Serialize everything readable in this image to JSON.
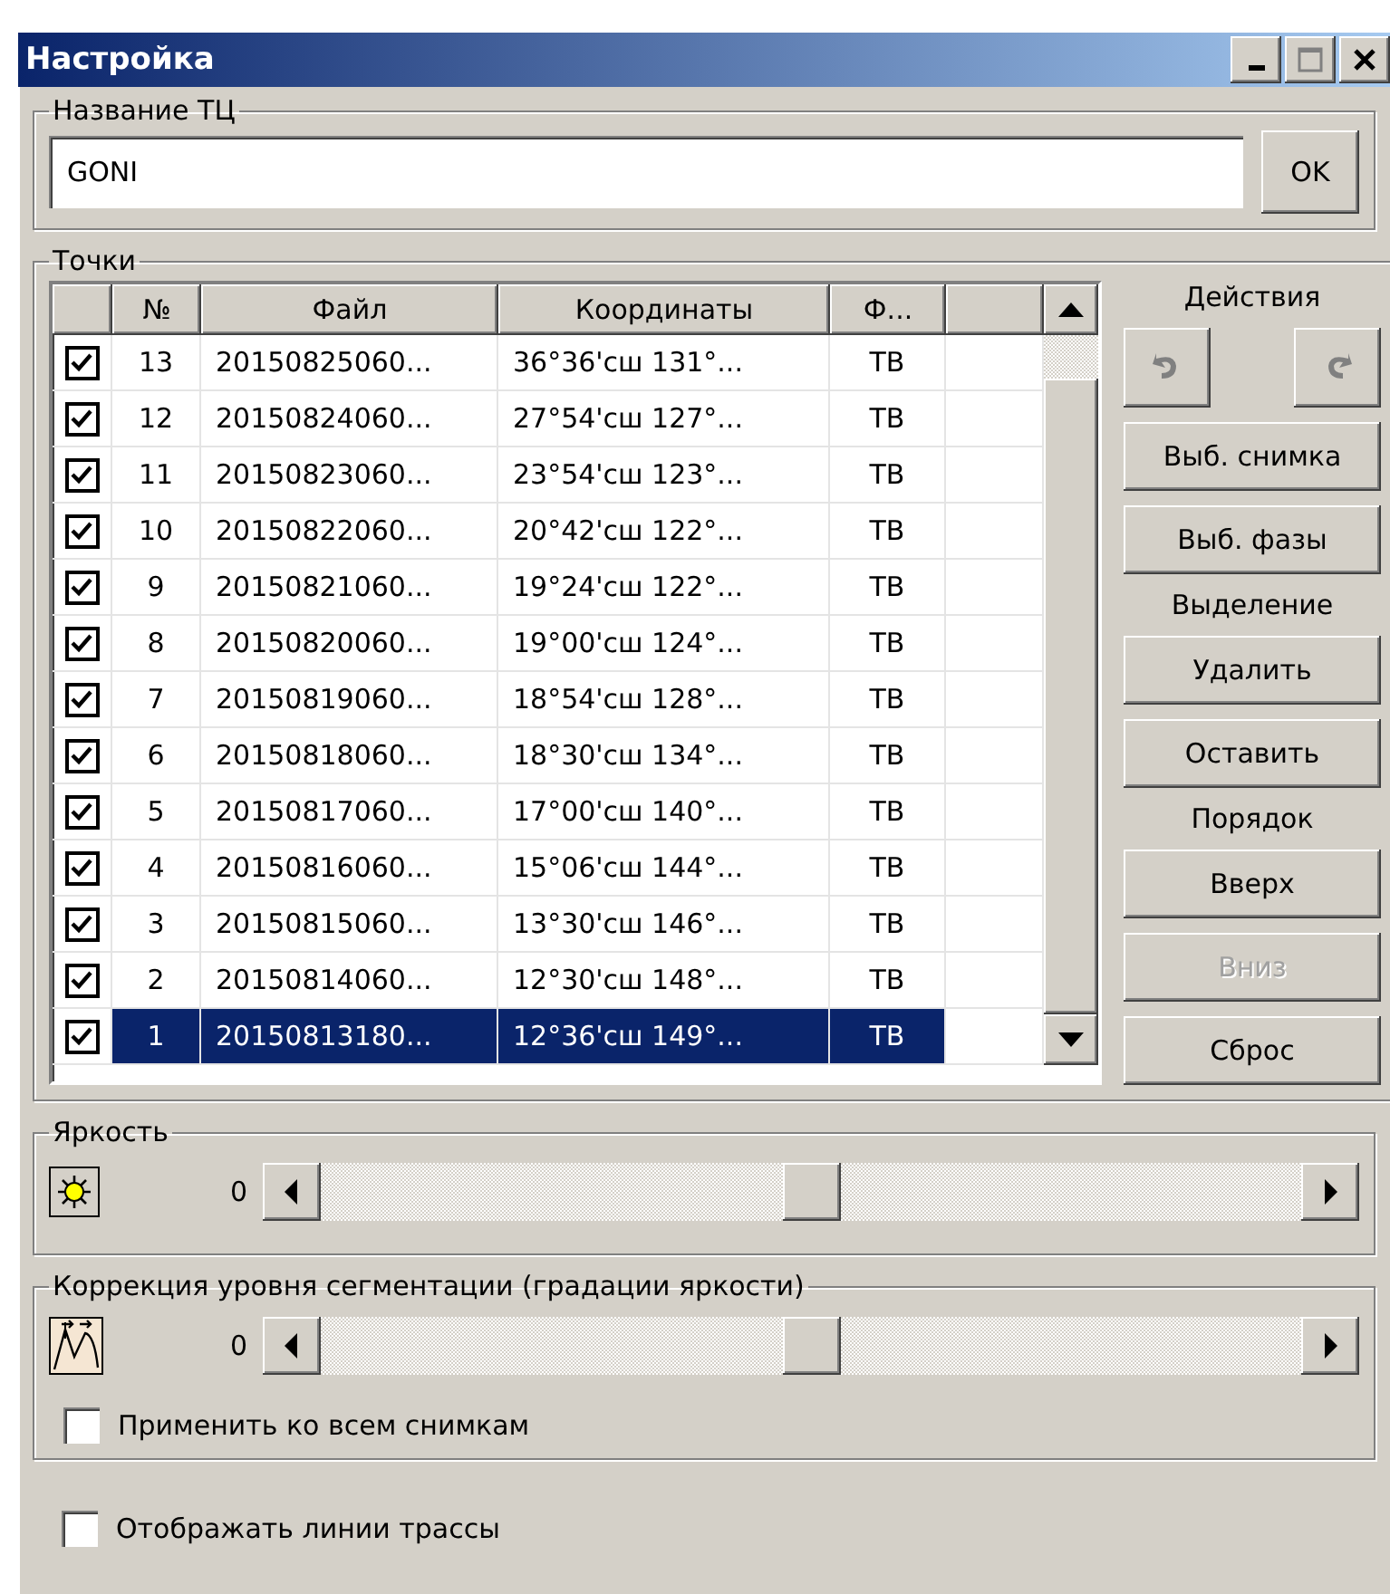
{
  "window": {
    "title": "Настройка"
  },
  "name_group": {
    "legend": "Название ТЦ",
    "field_value": "GONI",
    "ok_button": "OK"
  },
  "points_group": {
    "legend": "Точки",
    "table": {
      "columns": [
        "№",
        "Файл",
        "Координаты",
        "Ф..."
      ],
      "rows": [
        {
          "checked": true,
          "selected": false,
          "cells": [
            "13",
            "20150825060...",
            "36°36'сш 131°...",
            "ТВ"
          ]
        },
        {
          "checked": true,
          "selected": false,
          "cells": [
            "12",
            "20150824060...",
            "27°54'сш 127°...",
            "ТВ"
          ]
        },
        {
          "checked": true,
          "selected": false,
          "cells": [
            "11",
            "20150823060...",
            "23°54'сш 123°...",
            "ТВ"
          ]
        },
        {
          "checked": true,
          "selected": false,
          "cells": [
            "10",
            "20150822060...",
            "20°42'сш 122°...",
            "ТВ"
          ]
        },
        {
          "checked": true,
          "selected": false,
          "cells": [
            "9",
            "20150821060...",
            "19°24'сш 122°...",
            "ТВ"
          ]
        },
        {
          "checked": true,
          "selected": false,
          "cells": [
            "8",
            "20150820060...",
            "19°00'сш 124°...",
            "ТВ"
          ]
        },
        {
          "checked": true,
          "selected": false,
          "cells": [
            "7",
            "20150819060...",
            "18°54'сш 128°...",
            "ТВ"
          ]
        },
        {
          "checked": true,
          "selected": false,
          "cells": [
            "6",
            "20150818060...",
            "18°30'сш 134°...",
            "ТВ"
          ]
        },
        {
          "checked": true,
          "selected": false,
          "cells": [
            "5",
            "20150817060...",
            "17°00'сш 140°...",
            "ТВ"
          ]
        },
        {
          "checked": true,
          "selected": false,
          "cells": [
            "4",
            "20150816060...",
            "15°06'сш 144°...",
            "ТВ"
          ]
        },
        {
          "checked": true,
          "selected": false,
          "cells": [
            "3",
            "20150815060...",
            "13°30'сш 146°...",
            "ТВ"
          ]
        },
        {
          "checked": true,
          "selected": false,
          "cells": [
            "2",
            "20150814060...",
            "12°30'сш 148°...",
            "ТВ"
          ]
        },
        {
          "checked": true,
          "selected": true,
          "cells": [
            "1",
            "20150813180...",
            "12°36'сш 149°...",
            "ТВ"
          ]
        }
      ]
    },
    "side_panel": [
      {
        "kind": "heading",
        "text": "Действия"
      },
      {
        "kind": "icon_buttons",
        "buttons": [
          {
            "disabled": true
          },
          {
            "disabled": true
          }
        ]
      },
      {
        "kind": "button",
        "text": "Выб. снимка",
        "disabled": false
      },
      {
        "kind": "button",
        "text": "Выб. фазы",
        "disabled": false
      },
      {
        "kind": "heading",
        "text": "Выделение"
      },
      {
        "kind": "button",
        "text": "Удалить",
        "disabled": false
      },
      {
        "kind": "button",
        "text": "Оставить",
        "disabled": false
      },
      {
        "kind": "heading",
        "text": "Порядок"
      },
      {
        "kind": "button",
        "text": "Вверх",
        "disabled": false
      },
      {
        "kind": "button",
        "text": "Вниз",
        "disabled": true
      },
      {
        "kind": "button",
        "text": "Сброс",
        "disabled": false
      }
    ]
  },
  "brightness_group": {
    "legend": "Яркость",
    "value": "0",
    "level": 0.5
  },
  "segmentation_group": {
    "legend": "Коррекция уровня сегментации (градации яркости)",
    "value": "0",
    "level": 0.5,
    "apply_all": {
      "label": "Применить ко всем снимкам",
      "checked": false
    }
  },
  "show_track_lines": {
    "label": "Отображать линии трассы",
    "checked": false
  }
}
